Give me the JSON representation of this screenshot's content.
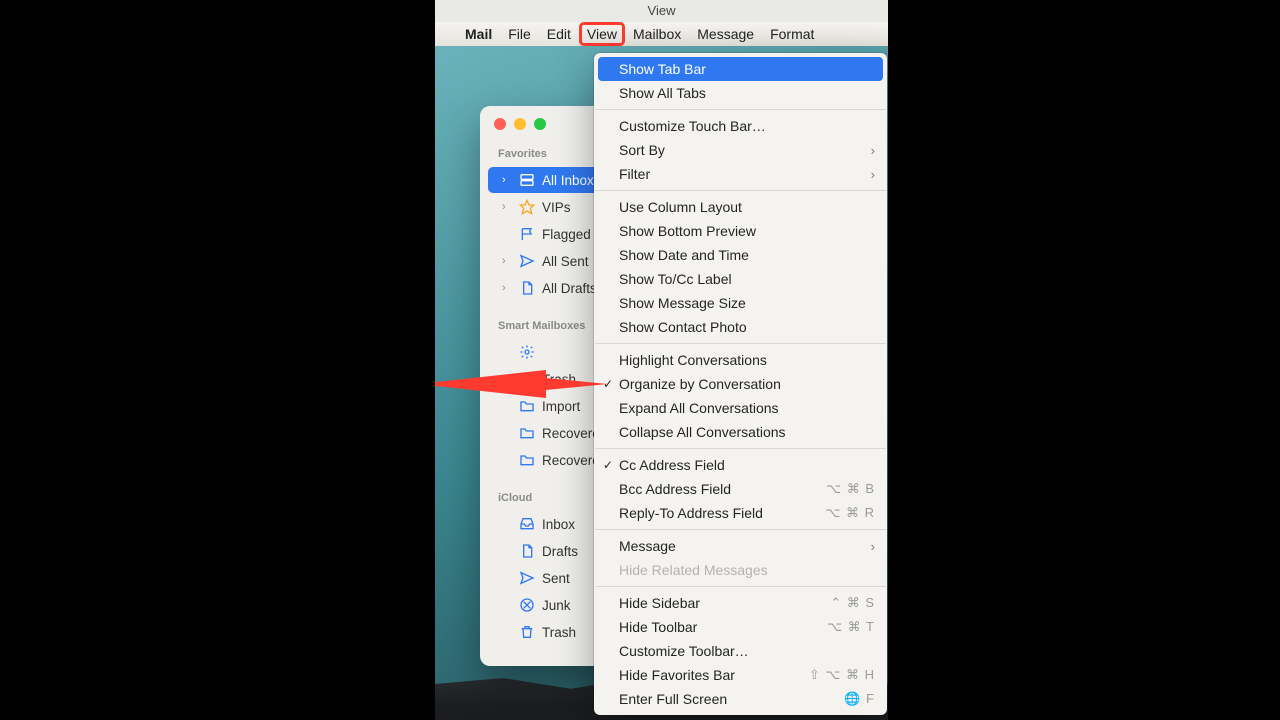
{
  "topbar_label": "View",
  "menubar": {
    "app": "Mail",
    "items": [
      "File",
      "Edit",
      "View",
      "Mailbox",
      "Message",
      "Format"
    ],
    "highlighted_index": 2
  },
  "sidebar": {
    "sections": [
      {
        "label": "Favorites",
        "items": [
          {
            "text": "All Inboxes",
            "icon": "inboxes",
            "chevron": true,
            "selected": true
          },
          {
            "text": "VIPs",
            "icon": "star",
            "chevron": true
          },
          {
            "text": "Flagged",
            "icon": "flag",
            "chevron": false
          },
          {
            "text": "All Sent",
            "icon": "sent",
            "chevron": true
          },
          {
            "text": "All Drafts",
            "icon": "doc",
            "chevron": true
          }
        ]
      },
      {
        "label": "Smart Mailboxes",
        "items": [
          {
            "text": "",
            "icon": "gear",
            "chevron": false
          },
          {
            "text": "Trash",
            "icon": "trash",
            "chevron": false
          },
          {
            "text": "Import",
            "icon": "folder",
            "chevron": false
          },
          {
            "text": "Recovered",
            "icon": "folder",
            "chevron": false
          },
          {
            "text": "Recovered",
            "icon": "folder",
            "chevron": false
          }
        ]
      },
      {
        "label": "iCloud",
        "items": [
          {
            "text": "Inbox",
            "icon": "inbox",
            "chevron": false
          },
          {
            "text": "Drafts",
            "icon": "doc",
            "chevron": false
          },
          {
            "text": "Sent",
            "icon": "sent",
            "chevron": false
          },
          {
            "text": "Junk",
            "icon": "junk",
            "chevron": false
          },
          {
            "text": "Trash",
            "icon": "trash",
            "chevron": false
          }
        ]
      }
    ]
  },
  "dropdown": {
    "groups": [
      [
        {
          "label": "Show Tab Bar",
          "hl": true
        },
        {
          "label": "Show All Tabs"
        }
      ],
      [
        {
          "label": "Customize Touch Bar…"
        },
        {
          "label": "Sort By",
          "submenu": true
        },
        {
          "label": "Filter",
          "submenu": true
        }
      ],
      [
        {
          "label": "Use Column Layout"
        },
        {
          "label": "Show Bottom Preview"
        },
        {
          "label": "Show Date and Time"
        },
        {
          "label": "Show To/Cc Label"
        },
        {
          "label": "Show Message Size"
        },
        {
          "label": "Show Contact Photo"
        }
      ],
      [
        {
          "label": "Highlight Conversations"
        },
        {
          "label": "Organize by Conversation",
          "checked": true
        },
        {
          "label": "Expand All Conversations"
        },
        {
          "label": "Collapse All Conversations"
        }
      ],
      [
        {
          "label": "Cc Address Field",
          "checked": true
        },
        {
          "label": "Bcc Address Field",
          "shortcut": "⌥ ⌘ B"
        },
        {
          "label": "Reply-To Address Field",
          "shortcut": "⌥ ⌘ R"
        }
      ],
      [
        {
          "label": "Message",
          "submenu": true
        },
        {
          "label": "Hide Related Messages",
          "disabled": true
        }
      ],
      [
        {
          "label": "Hide Sidebar",
          "shortcut": "⌃ ⌘ S"
        },
        {
          "label": "Hide Toolbar",
          "shortcut": "⌥ ⌘ T"
        },
        {
          "label": "Customize Toolbar…"
        },
        {
          "label": "Hide Favorites Bar",
          "shortcut": "⇧ ⌥ ⌘ H"
        },
        {
          "label": "Enter Full Screen",
          "shortcut": "🌐 F"
        }
      ]
    ]
  }
}
